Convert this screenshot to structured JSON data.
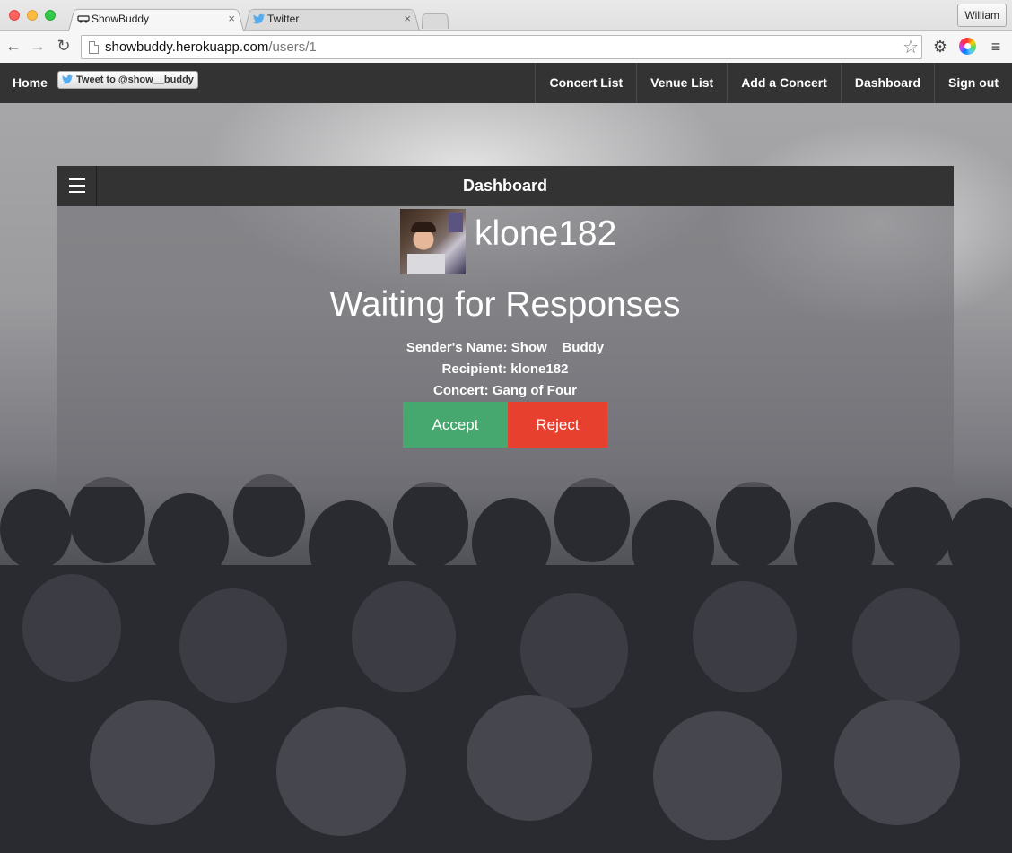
{
  "browser": {
    "tabs": [
      {
        "title": "ShowBuddy",
        "active": true
      },
      {
        "title": "Twitter",
        "active": false
      }
    ],
    "profile": "William",
    "url_host": "showbuddy.herokuapp.com",
    "url_path": "/users/1"
  },
  "nav": {
    "brand": "Home",
    "tweet": "Tweet to @show__buddy",
    "links": [
      "Concert List",
      "Venue List",
      "Add a Concert",
      "Dashboard",
      "Sign out"
    ]
  },
  "panel": {
    "title": "Dashboard",
    "username": "klone182",
    "heading": "Waiting for Responses",
    "sender": "Sender's Name: Show__Buddy",
    "recipient": "Recipient: klone182",
    "concert": "Concert: Gang of Four",
    "accept": "Accept",
    "reject": "Reject"
  },
  "colors": {
    "accept": "#46a86e",
    "reject": "#e8402f",
    "navbar": "#333333"
  }
}
